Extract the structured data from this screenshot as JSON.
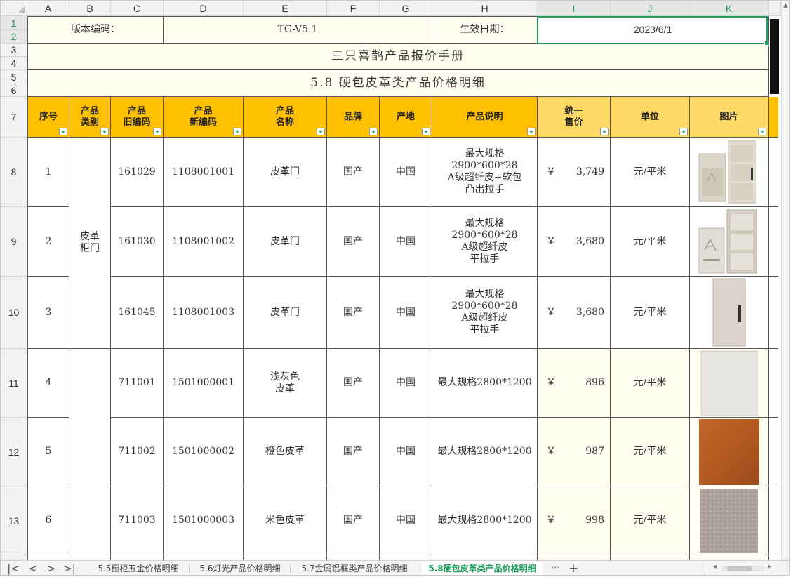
{
  "columns": [
    "A",
    "B",
    "C",
    "D",
    "E",
    "F",
    "G",
    "H",
    "I",
    "J",
    "K"
  ],
  "rows": [
    "1",
    "2",
    "3",
    "4",
    "5",
    "6",
    "7",
    "8",
    "9",
    "10",
    "11",
    "12",
    "13"
  ],
  "header_info": {
    "version_label": "版本编码：",
    "version_value": "TG-V5.1",
    "date_label": "生效日期：",
    "date_value": "2023/6/1"
  },
  "titles": {
    "manual": "三只喜鹊产品报价手册",
    "section": "5.8 硬包皮革类产品价格明细"
  },
  "table_headers": {
    "seq": "序号",
    "category_l1": "产品",
    "category_l2": "类别",
    "old_code_l1": "产品",
    "old_code_l2": "旧编码",
    "new_code_l1": "产品",
    "new_code_l2": "新编码",
    "name_l1": "产品",
    "name_l2": "名称",
    "brand": "品牌",
    "origin": "产地",
    "desc": "产品说明",
    "price_l1": "统一",
    "price_l2": "售价",
    "unit": "单位",
    "image": "图片"
  },
  "category_door_l1": "皮革",
  "category_door_l2": "柜门",
  "products": [
    {
      "seq": "1",
      "old": "161029",
      "new": "1108001001",
      "name_l1": "皮革门",
      "name_l2": "",
      "brand": "国产",
      "origin": "中国",
      "d1": "最大规格",
      "d2": "2900*600*28",
      "d3": "A级超纤皮+软包",
      "d4": "凸出拉手",
      "cur": "￥",
      "price": "3,749",
      "unit": "元/平米"
    },
    {
      "seq": "2",
      "old": "161030",
      "new": "1108001002",
      "name_l1": "皮革门",
      "name_l2": "",
      "brand": "国产",
      "origin": "中国",
      "d1": "最大规格",
      "d2": "2900*600*28",
      "d3": "A级超纤皮",
      "d4": "平拉手",
      "cur": "￥",
      "price": "3,680",
      "unit": "元/平米"
    },
    {
      "seq": "3",
      "old": "161045",
      "new": "1108001003",
      "name_l1": "皮革门",
      "name_l2": "",
      "brand": "国产",
      "origin": "中国",
      "d1": "最大规格",
      "d2": "2900*600*28",
      "d3": "A级超纤皮",
      "d4": "平拉手",
      "cur": "￥",
      "price": "3,680",
      "unit": "元/平米"
    },
    {
      "seq": "4",
      "old": "711001",
      "new": "1501000001",
      "name_l1": "浅灰色",
      "name_l2": "皮革",
      "brand": "国产",
      "origin": "中国",
      "d1": "最大规格2800*1200",
      "d2": "",
      "d3": "",
      "d4": "",
      "cur": "￥",
      "price": "896",
      "unit": "元/平米"
    },
    {
      "seq": "5",
      "old": "711002",
      "new": "1501000002",
      "name_l1": "橙色皮革",
      "name_l2": "",
      "brand": "国产",
      "origin": "中国",
      "d1": "最大规格2800*1200",
      "d2": "",
      "d3": "",
      "d4": "",
      "cur": "￥",
      "price": "987",
      "unit": "元/平米"
    },
    {
      "seq": "6",
      "old": "711003",
      "new": "1501000003",
      "name_l1": "米色皮革",
      "name_l2": "",
      "brand": "国产",
      "origin": "中国",
      "d1": "最大规格2800*1200",
      "d2": "",
      "d3": "",
      "d4": "",
      "cur": "￥",
      "price": "998",
      "unit": "元/平米"
    }
  ],
  "sheet_tabs": [
    {
      "label": "5.5橱柜五金价格明细",
      "active": false
    },
    {
      "label": "5.6灯光产品价格明细",
      "active": false
    },
    {
      "label": "5.7金属铝框类产品价格明细",
      "active": false
    },
    {
      "label": "5.8硬包皮革类产品价格明细",
      "active": true
    }
  ],
  "tab_more": "···",
  "tab_add": "+",
  "colors": {
    "header_orange": "#ffc000",
    "header_light": "#ffd966",
    "cream": "#fffef0",
    "selection": "#1e9e5a"
  }
}
